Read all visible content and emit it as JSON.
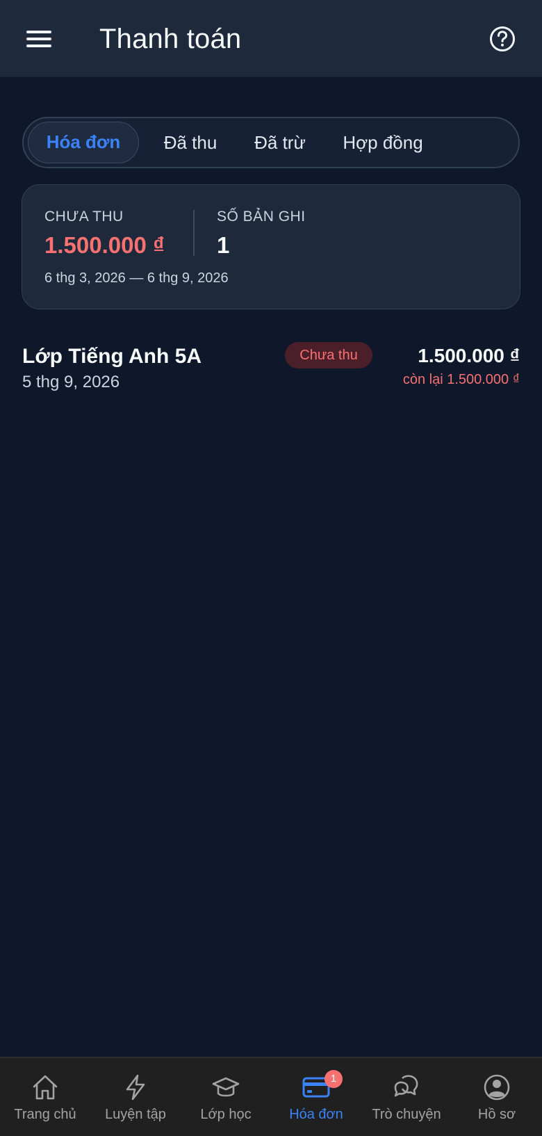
{
  "header": {
    "title": "Thanh toán"
  },
  "tabs": [
    {
      "label": "Hóa đơn",
      "active": true
    },
    {
      "label": "Đã thu",
      "active": false
    },
    {
      "label": "Đã trừ",
      "active": false
    },
    {
      "label": "Hợp đồng",
      "active": false
    }
  ],
  "summary": {
    "unpaid_label": "CHƯA THU",
    "unpaid_value": "1.500.000 ₫",
    "records_label": "SỐ BẢN GHI",
    "records_value": "1",
    "date_range": "6 thg 3, 2026 — 6 thg 9, 2026"
  },
  "invoices": [
    {
      "title": "Lớp Tiếng Anh 5A",
      "date": "5 thg 9, 2026",
      "status": "Chưa thu",
      "amount": "1.500.000 ₫",
      "remaining": "còn lại 1.500.000 ₫"
    }
  ],
  "bottom_nav": [
    {
      "label": "Trang chủ",
      "icon": "home-icon",
      "active": false
    },
    {
      "label": "Luyện tập",
      "icon": "lightning-icon",
      "active": false
    },
    {
      "label": "Lớp học",
      "icon": "graduation-cap-icon",
      "active": false
    },
    {
      "label": "Hóa đơn",
      "icon": "credit-card-icon",
      "active": true,
      "badge": "1"
    },
    {
      "label": "Trò chuyện",
      "icon": "chat-bubbles-icon",
      "active": false
    },
    {
      "label": "Hồ sơ",
      "icon": "user-circle-icon",
      "active": false
    }
  ],
  "colors": {
    "background": "#0f172a",
    "header": "#1e293b",
    "accent": "#3b82f6",
    "danger": "#f87171",
    "nav_background": "#202020"
  }
}
